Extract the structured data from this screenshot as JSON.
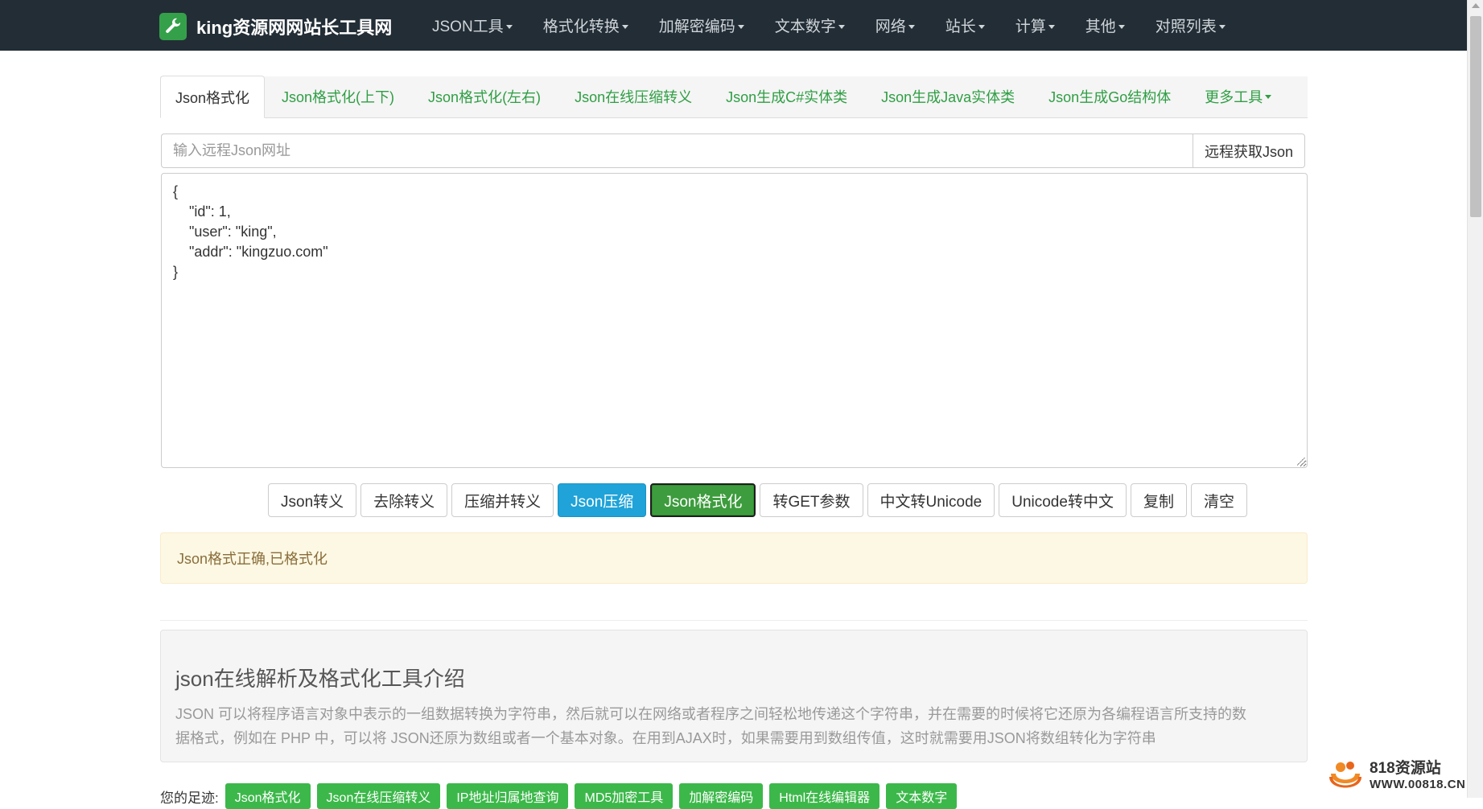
{
  "navbar": {
    "brand": "king资源网网站长工具网",
    "menu": [
      {
        "label": "JSON工具"
      },
      {
        "label": "格式化转换"
      },
      {
        "label": "加解密编码"
      },
      {
        "label": "文本数字"
      },
      {
        "label": "网络"
      },
      {
        "label": "站长"
      },
      {
        "label": "计算"
      },
      {
        "label": "其他"
      },
      {
        "label": "对照列表"
      }
    ]
  },
  "tabs": [
    {
      "label": "Json格式化",
      "active": true
    },
    {
      "label": "Json格式化(上下)"
    },
    {
      "label": "Json格式化(左右)"
    },
    {
      "label": "Json在线压缩转义"
    },
    {
      "label": "Json生成C#实体类"
    },
    {
      "label": "Json生成Java实体类"
    },
    {
      "label": "Json生成Go结构体"
    },
    {
      "label": "更多工具"
    }
  ],
  "remote": {
    "placeholder": "输入远程Json网址",
    "button": "远程获取Json"
  },
  "editor": {
    "content": "{\n    \"id\": 1,\n    \"user\": \"king\",\n    \"addr\": \"kingzuo.com\"\n}"
  },
  "actions": [
    {
      "label": "Json转义"
    },
    {
      "label": "去除转义"
    },
    {
      "label": "压缩并转义"
    },
    {
      "label": "Json压缩"
    },
    {
      "label": "Json格式化"
    },
    {
      "label": "转GET参数"
    },
    {
      "label": "中文转Unicode"
    },
    {
      "label": "Unicode转中文"
    },
    {
      "label": "复制"
    },
    {
      "label": "清空"
    }
  ],
  "status": {
    "message": "Json格式正确,已格式化"
  },
  "intro": {
    "title": "json在线解析及格式化工具介绍",
    "text": "JSON 可以将程序语言对象中表示的一组数据转换为字符串，然后就可以在网络或者程序之间轻松地传递这个字符串，并在需要的时候将它还原为各编程语言所支持的数据格式，例如在 PHP 中，可以将 JSON还原为数组或者一个基本对象。在用到AJAX时，如果需要用到数组传值，这时就需要用JSON将数组转化为字符串"
  },
  "footprints": {
    "label": "您的足迹:",
    "items": [
      "Json格式化",
      "Json在线压缩转义",
      "IP地址归属地查询",
      "MD5加密工具",
      "加解密编码",
      "Html在线编辑器",
      "文本数字"
    ]
  },
  "watermark": {
    "title": "818资源站",
    "url": "WWW.00818.CN"
  },
  "colors": {
    "navbar": "#222d36",
    "brand_icon": "#35a04a",
    "tab_link": "#2f9e44",
    "info_button": "#1fa3d8",
    "success_button": "#3d9c3d",
    "alert_bg": "#fcf8e3",
    "alert_text": "#8a6d3b",
    "footprint_tag": "#3cb84a"
  }
}
